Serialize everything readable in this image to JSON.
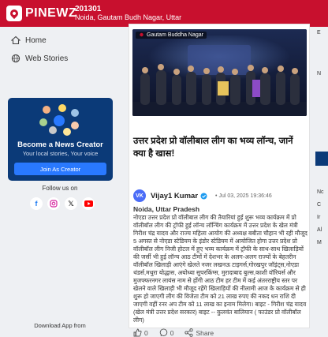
{
  "header": {
    "brand": "PINEWZ",
    "pincode": "201301",
    "location": "Noida, Gautam Budh Nagar, Uttar"
  },
  "sidebar": {
    "nav": [
      {
        "label": "Home",
        "icon": "home-icon"
      },
      {
        "label": "Web Stories",
        "icon": "web-stories-icon"
      }
    ],
    "creator": {
      "title": "Become a News Creator",
      "subtitle": "Your local stories, Your voice",
      "cta": "Join As Creator"
    },
    "follow_label": "Follow us on",
    "socials": [
      "facebook-icon",
      "instagram-icon",
      "x-icon",
      "youtube-icon"
    ],
    "download_label": "Download App from"
  },
  "article": {
    "image_tag": "Gautam Buddha Nagar",
    "title": "उत्तर प्रदेश प्रो वॉलीबाल लीग का भव्य लॉन्च, जानें क्या है खास!",
    "author": {
      "initials": "VK",
      "name": "Vijay1 Kumar",
      "date": "Jul 03, 2025 19:36:46"
    },
    "dateline": "Noida, Uttar Pradesh",
    "body": "नोएडा उत्तर प्रदेश प्रो वॉलीबाल लीग की तैयारियां हुई शुरू भव्य कार्यक्रम में प्रो वॉलीबॉल लीग की ट्रॉफी हुई लॉन्च लॉन्चिंग कार्यक्रम में उत्तर प्रदेश के खेल मंत्री गिरीश चंद्र यादव और राज्य महिला आयोग की अध्यक्ष बबीता चौहान भी रही मौजूद 5 अगस्त से नोएडा स्टेडियम के इंडोर स्टेडियम में आयोजित होगा उत्तर प्रदेश प्रो वॉलीबॉल लीग निजी होटल में हुए भव्य कार्यक्रम में ट्रॉफी के साथ-साथ खिलाड़ियों की जर्सी भी हुई लॉन्च आठ टीमों में देशभर के अलग-अलग राज्यों के बेहतरीन वॉलीबॉल खिलाड़ी आएंगे खेलते नजर लखनऊ टाइगर्स,गोरखपुर जॉइंट्स,नोएडा थंडर्स,मथुरा योद्धास, अयोध्या सुपरकिंग्स, मुरादाबाद बुल्स,काशी वॉरियर्स और मुजफ्फरनगर लायंस नाम से होंगी आठ टीम हर टीम में कई अंतरराष्ट्रीय स्तर पर खेलने वाले खिलाड़ी भी मौजूद रहेंगे खिलाड़ियों की नीलामी आज के कार्यक्रम से ही शुरू हो जाएगी लीग की विजेता टीम को 21 लाख रुपए की नकद धन राशि दी जाएगी वहीं रनर अप टीम को 11 लाख का इनाम मिलेगा। बाइट - गिरीश चंद्र यादव (खेल मंत्री उत्तर प्रदेश सरकार) बाइट -- कुलवंत बालियान ( फाउंडर प्रो वॉलीबॉल लीग)",
    "actions": {
      "likes": "0",
      "comments": "0",
      "share": "Share"
    }
  },
  "right_partial": {
    "lines": [
      "E",
      "N",
      "Nc",
      "C",
      "Ir",
      "Al",
      "M"
    ]
  },
  "colors": {
    "brand_red": "#c8102e",
    "creator_blue": "#0b3a78",
    "cta_blue": "#2979ff"
  }
}
